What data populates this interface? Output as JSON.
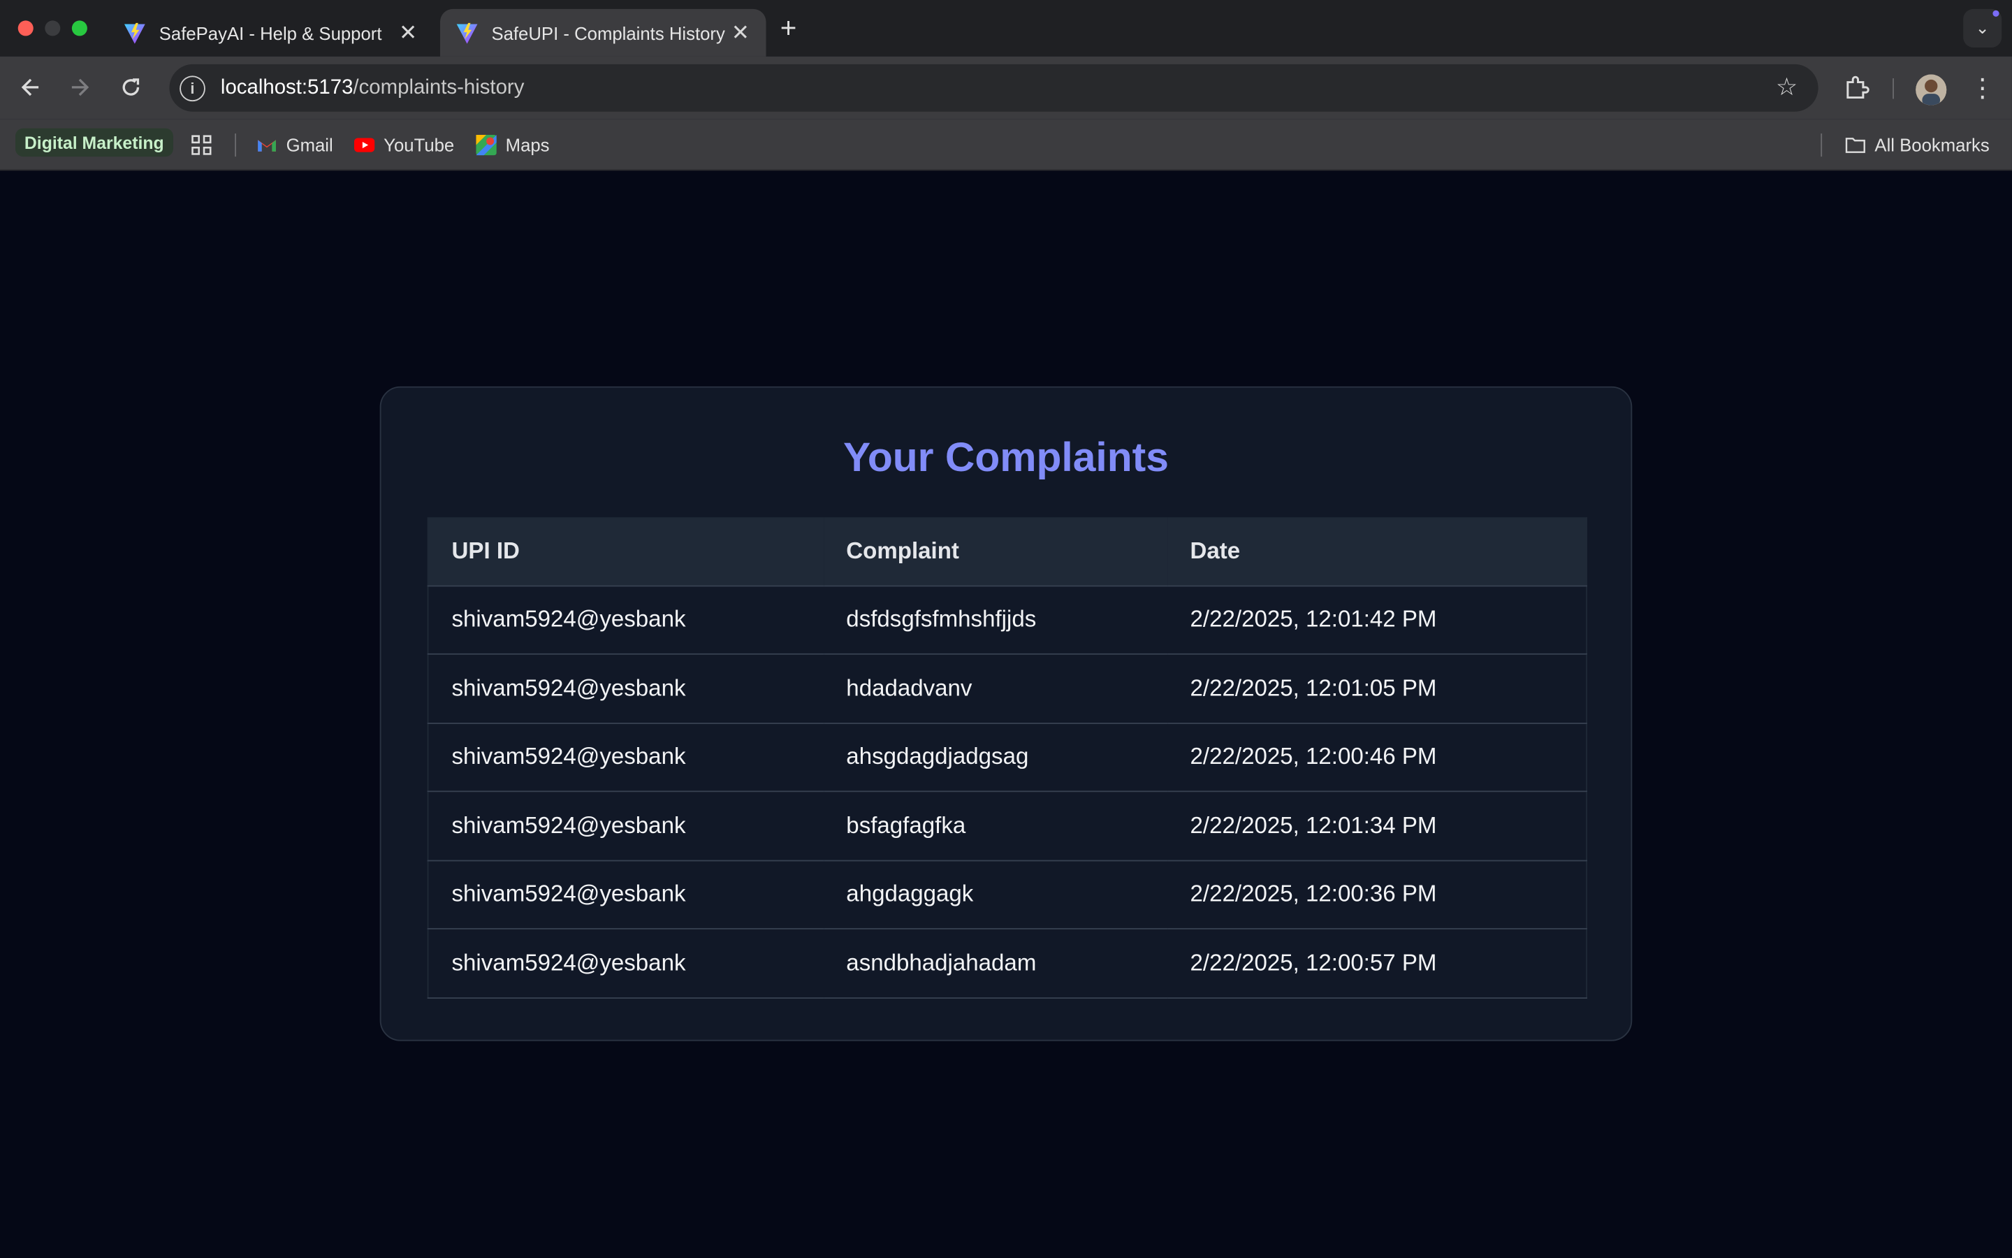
{
  "browser": {
    "tabs": [
      {
        "title": "SafePayAI - Help & Support",
        "active": false
      },
      {
        "title": "SafeUPI - Complaints History",
        "active": true
      }
    ],
    "url_host": "localhost:5173",
    "url_path": "/complaints-history",
    "bookmarks": {
      "folder_chip": "Digital Marketing",
      "items": [
        "Gmail",
        "YouTube",
        "Maps"
      ],
      "all_bookmarks": "All Bookmarks"
    }
  },
  "page": {
    "title": "Your Complaints",
    "table": {
      "headers": [
        "UPI ID",
        "Complaint",
        "Date"
      ],
      "rows": [
        [
          "shivam5924@yesbank",
          "dsfdsgfsfmhshfjjds",
          "2/22/2025, 12:01:42 PM"
        ],
        [
          "shivam5924@yesbank",
          "hdadadvanv",
          "2/22/2025, 12:01:05 PM"
        ],
        [
          "shivam5924@yesbank",
          "ahsgdagdjadgsag",
          "2/22/2025, 12:00:46 PM"
        ],
        [
          "shivam5924@yesbank",
          "bsfagfagfka",
          "2/22/2025, 12:01:34 PM"
        ],
        [
          "shivam5924@yesbank",
          "ahgdaggagk",
          "2/22/2025, 12:00:36 PM"
        ],
        [
          "shivam5924@yesbank",
          "asndbhadjahadam",
          "2/22/2025, 12:00:57 PM"
        ]
      ]
    }
  },
  "colors": {
    "accent": "#818cf8",
    "page_bg": "#050816",
    "card_bg": "#111827",
    "header_row_bg": "#1f2937"
  },
  "icons": {
    "tab_favicon": "vite-logo-icon",
    "back": "arrow-left-icon",
    "forward": "arrow-right-icon",
    "reload": "reload-icon",
    "site_info": "info-icon",
    "bookmark_star": "star-icon",
    "extensions": "puzzle-icon",
    "menu": "kebab-icon",
    "apps": "grid-icon",
    "folder": "folder-icon"
  }
}
